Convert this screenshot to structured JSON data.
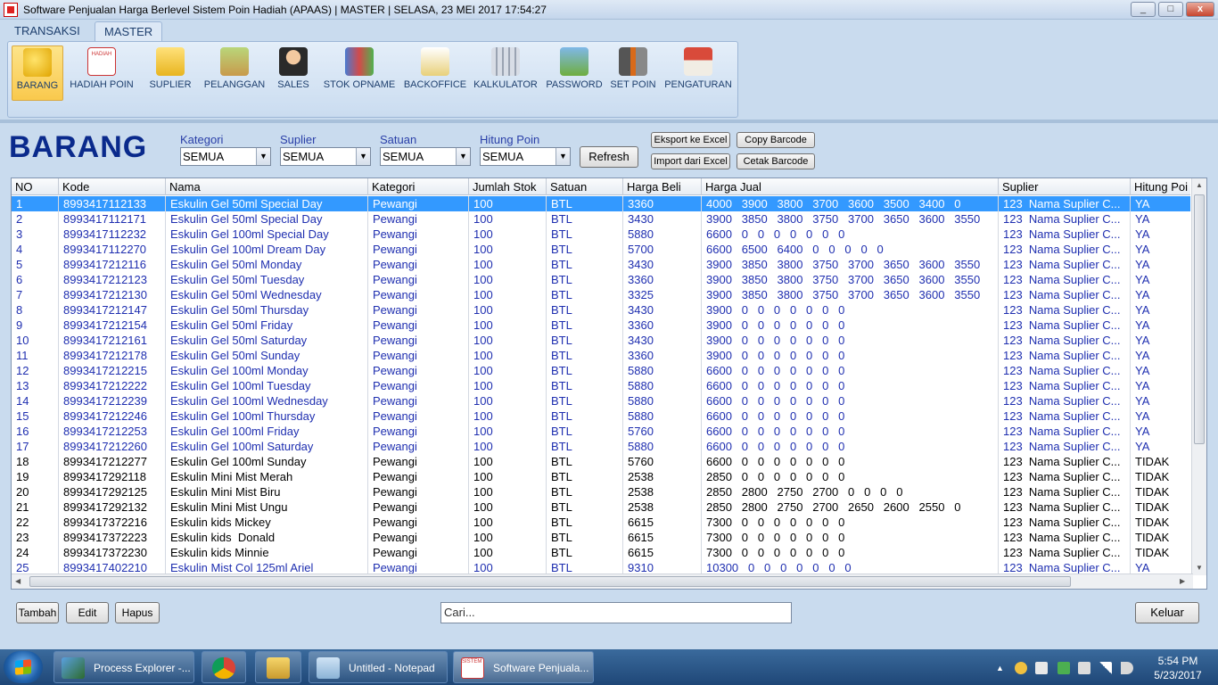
{
  "window": {
    "title": "Software Penjualan Harga Berlevel Sistem Poin Hadiah (APAAS)  |  MASTER  |  SELASA, 23  MEI 2017  17:54:27",
    "min": "_",
    "max": "□",
    "close": "x"
  },
  "tabs": [
    "TRANSAKSI",
    "MASTER"
  ],
  "ribbon": [
    "BARANG",
    "HADIAH POIN",
    "SUPLIER",
    "PELANGGAN",
    "SALES",
    "STOK OPNAME",
    "BACKOFFICE",
    "KALKULATOR",
    "PASSWORD",
    "SET POIN",
    "PENGATURAN"
  ],
  "ribbon_icon_text": "HADIAH",
  "page_title": "BARANG",
  "filters": [
    {
      "label": "Kategori",
      "value": "SEMUA"
    },
    {
      "label": "Suplier",
      "value": "SEMUA"
    },
    {
      "label": "Satuan",
      "value": "SEMUA"
    },
    {
      "label": "Hitung Poin",
      "value": "SEMUA"
    }
  ],
  "buttons": {
    "refresh": "Refresh",
    "export": "Eksport ke Excel",
    "import": "Import dari Excel",
    "copy": "Copy Barcode",
    "print": "Cetak Barcode",
    "add": "Tambah",
    "edit": "Edit",
    "delete": "Hapus",
    "exit": "Keluar"
  },
  "search": {
    "placeholder": "Cari..."
  },
  "columns": [
    "NO",
    "Kode",
    "Nama",
    "Kategori",
    "Jumlah Stok",
    "Satuan",
    "Harga Beli",
    "Harga Jual",
    "Suplier",
    "Hitung Poi"
  ],
  "rows": [
    [
      "1",
      "8993417112133",
      "Eskulin Gel 50ml Special Day",
      "Pewangi",
      "100",
      "BTL",
      "3360",
      "4000   3900   3800   3700   3600   3500   3400   0",
      "123  Nama Suplier C...",
      "YA"
    ],
    [
      "2",
      "8993417112171",
      "Eskulin Gel 50ml Special Day",
      "Pewangi",
      "100",
      "BTL",
      "3430",
      "3900   3850   3800   3750   3700   3650   3600   3550",
      "123  Nama Suplier C...",
      "YA"
    ],
    [
      "3",
      "8993417112232",
      "Eskulin Gel 100ml Special Day",
      "Pewangi",
      "100",
      "BTL",
      "5880",
      "6600   0   0   0   0   0   0   0",
      "123  Nama Suplier C...",
      "YA"
    ],
    [
      "4",
      "8993417112270",
      "Eskulin Gel 100ml Dream Day",
      "Pewangi",
      "100",
      "BTL",
      "5700",
      "6600   6500   6400   0   0   0   0   0",
      "123  Nama Suplier C...",
      "YA"
    ],
    [
      "5",
      "8993417212116",
      "Eskulin Gel 50ml Monday",
      "Pewangi",
      "100",
      "BTL",
      "3430",
      "3900   3850   3800   3750   3700   3650   3600   3550",
      "123  Nama Suplier C...",
      "YA"
    ],
    [
      "6",
      "8993417212123",
      "Eskulin Gel 50ml Tuesday",
      "Pewangi",
      "100",
      "BTL",
      "3360",
      "3900   3850   3800   3750   3700   3650   3600   3550",
      "123  Nama Suplier C...",
      "YA"
    ],
    [
      "7",
      "8993417212130",
      "Eskulin Gel 50ml Wednesday",
      "Pewangi",
      "100",
      "BTL",
      "3325",
      "3900   3850   3800   3750   3700   3650   3600   3550",
      "123  Nama Suplier C...",
      "YA"
    ],
    [
      "8",
      "8993417212147",
      "Eskulin Gel 50ml Thursday",
      "Pewangi",
      "100",
      "BTL",
      "3430",
      "3900   0   0   0   0   0   0   0",
      "123  Nama Suplier C...",
      "YA"
    ],
    [
      "9",
      "8993417212154",
      "Eskulin Gel 50ml Friday",
      "Pewangi",
      "100",
      "BTL",
      "3360",
      "3900   0   0   0   0   0   0   0",
      "123  Nama Suplier C...",
      "YA"
    ],
    [
      "10",
      "8993417212161",
      "Eskulin Gel 50ml Saturday",
      "Pewangi",
      "100",
      "BTL",
      "3430",
      "3900   0   0   0   0   0   0   0",
      "123  Nama Suplier C...",
      "YA"
    ],
    [
      "11",
      "8993417212178",
      "Eskulin Gel 50ml Sunday",
      "Pewangi",
      "100",
      "BTL",
      "3360",
      "3900   0   0   0   0   0   0   0",
      "123  Nama Suplier C...",
      "YA"
    ],
    [
      "12",
      "8993417212215",
      "Eskulin Gel 100ml Monday",
      "Pewangi",
      "100",
      "BTL",
      "5880",
      "6600   0   0   0   0   0   0   0",
      "123  Nama Suplier C...",
      "YA"
    ],
    [
      "13",
      "8993417212222",
      "Eskulin Gel 100ml Tuesday",
      "Pewangi",
      "100",
      "BTL",
      "5880",
      "6600   0   0   0   0   0   0   0",
      "123  Nama Suplier C...",
      "YA"
    ],
    [
      "14",
      "8993417212239",
      "Eskulin Gel 100ml Wednesday",
      "Pewangi",
      "100",
      "BTL",
      "5880",
      "6600   0   0   0   0   0   0   0",
      "123  Nama Suplier C...",
      "YA"
    ],
    [
      "15",
      "8993417212246",
      "Eskulin Gel 100ml Thursday",
      "Pewangi",
      "100",
      "BTL",
      "5880",
      "6600   0   0   0   0   0   0   0",
      "123  Nama Suplier C...",
      "YA"
    ],
    [
      "16",
      "8993417212253",
      "Eskulin Gel 100ml Friday",
      "Pewangi",
      "100",
      "BTL",
      "5760",
      "6600   0   0   0   0   0   0   0",
      "123  Nama Suplier C...",
      "YA"
    ],
    [
      "17",
      "8993417212260",
      "Eskulin Gel 100ml Saturday",
      "Pewangi",
      "100",
      "BTL",
      "5880",
      "6600   0   0   0   0   0   0   0",
      "123  Nama Suplier C...",
      "YA"
    ],
    [
      "18",
      "8993417212277",
      "Eskulin Gel 100ml Sunday",
      "Pewangi",
      "100",
      "BTL",
      "5760",
      "6600   0   0   0   0   0   0   0",
      "123  Nama Suplier C...",
      "TIDAK"
    ],
    [
      "19",
      "8993417292118",
      "Eskulin Mini Mist Merah",
      "Pewangi",
      "100",
      "BTL",
      "2538",
      "2850   0   0   0   0   0   0   0",
      "123  Nama Suplier C...",
      "TIDAK"
    ],
    [
      "20",
      "8993417292125",
      "Eskulin Mini Mist Biru",
      "Pewangi",
      "100",
      "BTL",
      "2538",
      "2850   2800   2750   2700   0   0   0   0",
      "123  Nama Suplier C...",
      "TIDAK"
    ],
    [
      "21",
      "8993417292132",
      "Eskulin Mini Mist Ungu",
      "Pewangi",
      "100",
      "BTL",
      "2538",
      "2850   2800   2750   2700   2650   2600   2550   0",
      "123  Nama Suplier C...",
      "TIDAK"
    ],
    [
      "22",
      "8993417372216",
      "Eskulin kids Mickey",
      "Pewangi",
      "100",
      "BTL",
      "6615",
      "7300   0   0   0   0   0   0   0",
      "123  Nama Suplier C...",
      "TIDAK"
    ],
    [
      "23",
      "8993417372223",
      "Eskulin kids  Donald",
      "Pewangi",
      "100",
      "BTL",
      "6615",
      "7300   0   0   0   0   0   0   0",
      "123  Nama Suplier C...",
      "TIDAK"
    ],
    [
      "24",
      "8993417372230",
      "Eskulin kids Minnie",
      "Pewangi",
      "100",
      "BTL",
      "6615",
      "7300   0   0   0   0   0   0   0",
      "123  Nama Suplier C...",
      "TIDAK"
    ],
    [
      "25",
      "8993417402210",
      "Eskulin Mist Col 125ml Ariel",
      "Pewangi",
      "100",
      "BTL",
      "9310",
      "10300   0   0   0   0   0   0   0",
      "123  Nama Suplier C...",
      "YA"
    ]
  ],
  "selected_row": 0,
  "taskbar": {
    "items": [
      "Process Explorer -...",
      "",
      "",
      "Untitled - Notepad",
      "Software Penjuala..."
    ],
    "app_icon_text": "SISTEM POIN",
    "time": "5:54 PM",
    "date": "5/23/2017"
  }
}
